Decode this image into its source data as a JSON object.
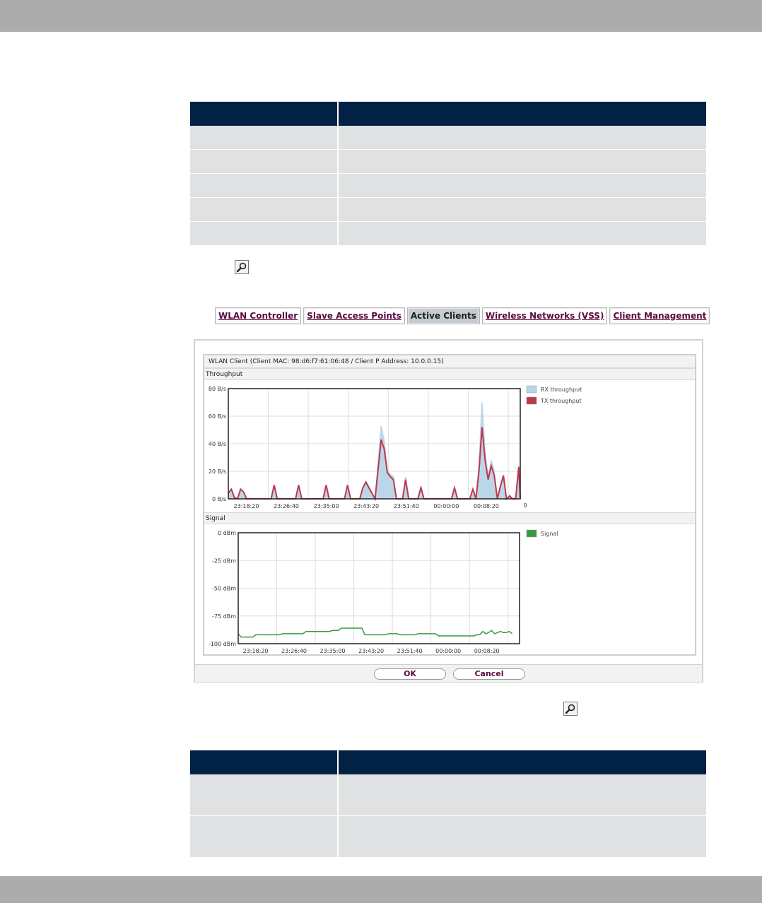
{
  "dialog": {
    "tabs": [
      {
        "label": "WLAN Controller",
        "active": false
      },
      {
        "label": "Slave Access Points",
        "active": false
      },
      {
        "label": "Active Clients",
        "active": true
      },
      {
        "label": "Wireless Networks (VSS)",
        "active": false
      },
      {
        "label": "Client Management",
        "active": false
      }
    ],
    "title": "WLAN Client (Client MAC: 98:d6:f7:61:06:48 / Client P Address: 10.0.0.15)",
    "sections": {
      "throughput": "Throughput",
      "signal": "Signal"
    },
    "buttons": {
      "ok": "OK",
      "cancel": "Cancel"
    }
  },
  "icons": {
    "zoom": "magnifier-icon"
  },
  "colors": {
    "table_header": "#012145",
    "table_cell": "#dfe1e3",
    "rx": "#b8d4e8",
    "tx": "#c0394b",
    "signal": "#3a9a3a",
    "link": "#5b0a3f"
  },
  "chart_data": [
    {
      "type": "line",
      "yticks": [
        "80 B/s",
        "60 B/s",
        "40 B/s",
        "20 B/s",
        "0 B/s"
      ],
      "ylim": [
        0,
        80
      ],
      "xticks": [
        "23:18:20",
        "23:26:40",
        "23:35:00",
        "23:43:20",
        "23:51:40",
        "00:00:00",
        "00:08:20"
      ],
      "xextra": "0",
      "legend": [
        "RX throughput",
        "TX throughput"
      ],
      "series": [
        {
          "name": "RX throughput",
          "color": "#b8d4e8",
          "points": [
            [
              0,
              4
            ],
            [
              1,
              7
            ],
            [
              2,
              1
            ],
            [
              3,
              0
            ],
            [
              4,
              7
            ],
            [
              5,
              5
            ],
            [
              6,
              0
            ],
            [
              14,
              0
            ],
            [
              15,
              10
            ],
            [
              16,
              0
            ],
            [
              22,
              0
            ],
            [
              23,
              10
            ],
            [
              24,
              0
            ],
            [
              31,
              0
            ],
            [
              32,
              10
            ],
            [
              33,
              0
            ],
            [
              38,
              0
            ],
            [
              39,
              10
            ],
            [
              40,
              0
            ],
            [
              43,
              0
            ],
            [
              44,
              8
            ],
            [
              45,
              13
            ],
            [
              46,
              9
            ],
            [
              48,
              0
            ],
            [
              50,
              53
            ],
            [
              51,
              42
            ],
            [
              52,
              21
            ],
            [
              53,
              18
            ],
            [
              54,
              16
            ],
            [
              55,
              0
            ],
            [
              57,
              0
            ],
            [
              58,
              16
            ],
            [
              59,
              0
            ],
            [
              62,
              0
            ],
            [
              63,
              9
            ],
            [
              64,
              0
            ],
            [
              73,
              0
            ],
            [
              74,
              8
            ],
            [
              75,
              0
            ],
            [
              79,
              0
            ],
            [
              80,
              7
            ],
            [
              81,
              0
            ],
            [
              82,
              25
            ],
            [
              83,
              70
            ],
            [
              84,
              34
            ],
            [
              85,
              16
            ],
            [
              86,
              28
            ],
            [
              87,
              20
            ],
            [
              88,
              0
            ],
            [
              89,
              10
            ],
            [
              90,
              17
            ],
            [
              91,
              0
            ],
            [
              92,
              3
            ],
            [
              93,
              0
            ],
            [
              94,
              0
            ],
            [
              95,
              24
            ],
            [
              95.5,
              0
            ]
          ]
        },
        {
          "name": "TX throughput",
          "color": "#c0394b",
          "points": [
            [
              0,
              4
            ],
            [
              1,
              7
            ],
            [
              2,
              1
            ],
            [
              3,
              0
            ],
            [
              4,
              7
            ],
            [
              5,
              5
            ],
            [
              6,
              0
            ],
            [
              14,
              0
            ],
            [
              15,
              10
            ],
            [
              16,
              0
            ],
            [
              22,
              0
            ],
            [
              23,
              10
            ],
            [
              24,
              0
            ],
            [
              31,
              0
            ],
            [
              32,
              10
            ],
            [
              33,
              0
            ],
            [
              38,
              0
            ],
            [
              39,
              10
            ],
            [
              40,
              0
            ],
            [
              43,
              0
            ],
            [
              44,
              8
            ],
            [
              45,
              12
            ],
            [
              46,
              8
            ],
            [
              48,
              0
            ],
            [
              50,
              43
            ],
            [
              51,
              36
            ],
            [
              52,
              19
            ],
            [
              53,
              16
            ],
            [
              54,
              14
            ],
            [
              55,
              0
            ],
            [
              57,
              0
            ],
            [
              58,
              14
            ],
            [
              59,
              0
            ],
            [
              62,
              0
            ],
            [
              63,
              8
            ],
            [
              64,
              0
            ],
            [
              73,
              0
            ],
            [
              74,
              8
            ],
            [
              75,
              0
            ],
            [
              79,
              0
            ],
            [
              80,
              7
            ],
            [
              81,
              0
            ],
            [
              82,
              20
            ],
            [
              83,
              52
            ],
            [
              84,
              28
            ],
            [
              85,
              14
            ],
            [
              86,
              24
            ],
            [
              87,
              17
            ],
            [
              88,
              0
            ],
            [
              89,
              9
            ],
            [
              90,
              17
            ],
            [
              91,
              0
            ],
            [
              92,
              2
            ],
            [
              93,
              0
            ],
            [
              94,
              0
            ],
            [
              95,
              23
            ],
            [
              95.5,
              0
            ]
          ]
        }
      ]
    },
    {
      "type": "line",
      "yticks": [
        "0 dBm",
        "-25 dBm",
        "-50 dBm",
        "-75 dBm",
        "-100 dBm"
      ],
      "ylim": [
        -100,
        0
      ],
      "xticks": [
        "23:18:20",
        "23:26:40",
        "23:35:00",
        "23:43:20",
        "23:51:40",
        "00:00:00",
        "00:08:20"
      ],
      "legend": [
        "Signal"
      ],
      "series": [
        {
          "name": "Signal",
          "color": "#3a9a3a",
          "points": [
            [
              0,
              -91
            ],
            [
              1,
              -94
            ],
            [
              5,
              -94
            ],
            [
              6,
              -92
            ],
            [
              14,
              -92
            ],
            [
              15,
              -91
            ],
            [
              22,
              -91
            ],
            [
              23,
              -89
            ],
            [
              31,
              -89
            ],
            [
              32,
              -88
            ],
            [
              34,
              -88
            ],
            [
              35,
              -86
            ],
            [
              42,
              -86
            ],
            [
              43,
              -92
            ],
            [
              50,
              -92
            ],
            [
              51,
              -91
            ],
            [
              54,
              -91
            ],
            [
              55,
              -92
            ],
            [
              60,
              -92
            ],
            [
              61,
              -91
            ],
            [
              67,
              -91
            ],
            [
              68,
              -93
            ],
            [
              80,
              -93
            ],
            [
              81,
              -92
            ],
            [
              82,
              -92
            ],
            [
              83,
              -89
            ],
            [
              84,
              -91
            ],
            [
              85,
              -90
            ],
            [
              86,
              -88
            ],
            [
              87,
              -91
            ],
            [
              88,
              -90
            ],
            [
              89,
              -89
            ],
            [
              90,
              -90
            ],
            [
              91,
              -90
            ],
            [
              92,
              -89
            ],
            [
              93,
              -91
            ]
          ]
        }
      ]
    }
  ]
}
